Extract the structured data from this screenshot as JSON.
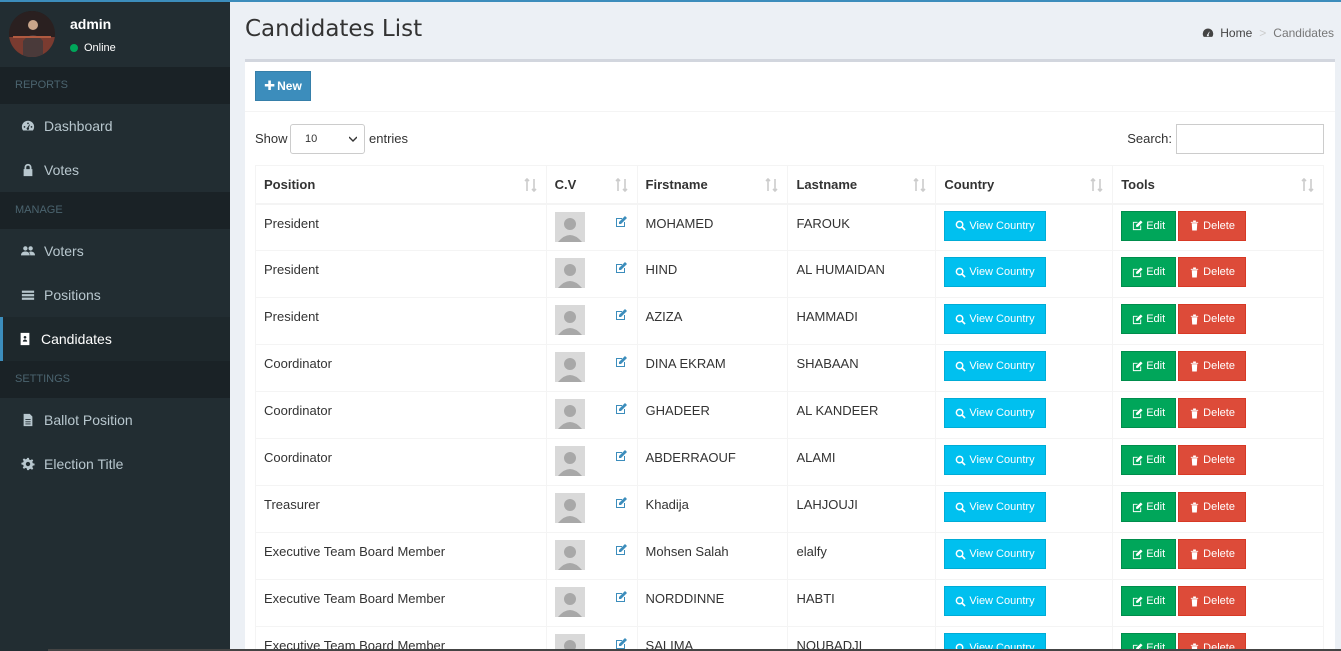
{
  "user": {
    "name": "admin",
    "status": "Online"
  },
  "sidebar": {
    "sections": [
      {
        "header": "REPORTS",
        "items": [
          {
            "label": "Dashboard",
            "icon": "dashboard-icon"
          },
          {
            "label": "Votes",
            "icon": "lock-icon"
          }
        ]
      },
      {
        "header": "MANAGE",
        "items": [
          {
            "label": "Voters",
            "icon": "users-icon"
          },
          {
            "label": "Positions",
            "icon": "list-icon"
          },
          {
            "label": "Candidates",
            "icon": "id-card-icon",
            "active": true
          }
        ]
      },
      {
        "header": "SETTINGS",
        "items": [
          {
            "label": "Ballot Position",
            "icon": "file-icon"
          },
          {
            "label": "Election Title",
            "icon": "gear-icon"
          }
        ]
      }
    ]
  },
  "page": {
    "title": "Candidates List"
  },
  "breadcrumb": {
    "home": "Home",
    "current": "Candidates"
  },
  "toolbar": {
    "new_label": "New"
  },
  "datatable": {
    "show_label": "Show",
    "length_value": "10",
    "entries_label": "entries",
    "search_label": "Search:",
    "search_value": ""
  },
  "table": {
    "columns": [
      "Position",
      "C.V",
      "Firstname",
      "Lastname",
      "Country",
      "Tools"
    ],
    "view_country_label": "View Country",
    "edit_label": "Edit",
    "delete_label": "Delete",
    "rows": [
      {
        "position": "President",
        "firstname": "MOHAMED",
        "lastname": "FAROUK"
      },
      {
        "position": "President",
        "firstname": "HIND",
        "lastname": "AL HUMAIDAN"
      },
      {
        "position": "President",
        "firstname": "AZIZA",
        "lastname": "HAMMADI"
      },
      {
        "position": "Coordinator",
        "firstname": "DINA EKRAM",
        "lastname": "SHABAAN"
      },
      {
        "position": "Coordinator",
        "firstname": "GHADEER",
        "lastname": "AL KANDEER"
      },
      {
        "position": "Coordinator",
        "firstname": "ABDERRAOUF",
        "lastname": "ALAMI"
      },
      {
        "position": "Treasurer",
        "firstname": "Khadija",
        "lastname": "LAHJOUJI"
      },
      {
        "position": "Executive Team Board Member",
        "firstname": "Mohsen Salah",
        "lastname": "elalfy"
      },
      {
        "position": "Executive Team Board Member",
        "firstname": "NORDDINNE",
        "lastname": "HABTI"
      },
      {
        "position": "Executive Team Board Member",
        "firstname": "SALIMA",
        "lastname": "NOUBADJI"
      }
    ]
  },
  "colors": {
    "sidebar_bg": "#222d32",
    "primary": "#3c8dbc",
    "info": "#00c0ef",
    "success": "#00a65a",
    "danger": "#dd4b39"
  }
}
